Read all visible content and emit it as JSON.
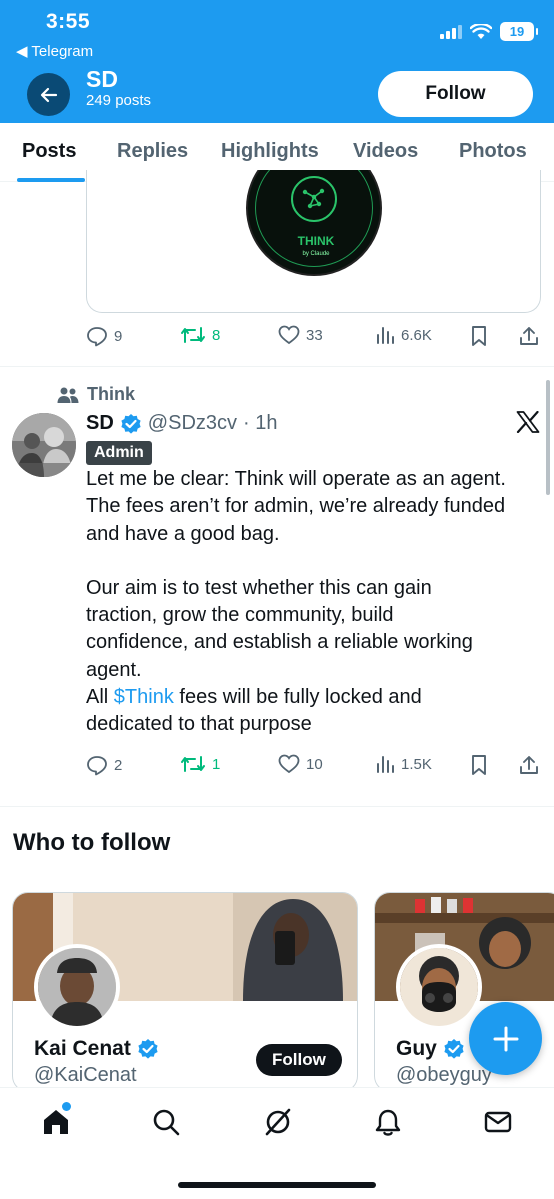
{
  "status_bar": {
    "time": "3:55",
    "back_app": "◀ Telegram",
    "battery": "19"
  },
  "header": {
    "name": "SD",
    "posts": "249 posts",
    "follow_label": "Follow"
  },
  "tabs": [
    {
      "label": "Posts",
      "active": true
    },
    {
      "label": "Replies"
    },
    {
      "label": "Highlights"
    },
    {
      "label": "Videos"
    },
    {
      "label": "Photos"
    }
  ],
  "post1": {
    "image": {
      "logo_text": "THINK",
      "logo_sub": "by Claude"
    },
    "replies": "9",
    "reposts": "8",
    "likes": "33",
    "views": "6.6K"
  },
  "post2": {
    "community": "Think",
    "name": "SD",
    "handle": "@SDz3cv",
    "time": "· 1h",
    "badge": "Admin",
    "text_lines": [
      "Let me be clear: Think will operate as an agent.",
      "The fees aren’t for admin, we’re already funded",
      "and have a good bag."
    ],
    "text_lines2": [
      "Our aim is to test whether this can gain",
      "traction, grow the community, build",
      "confidence, and establish a reliable working",
      "agent."
    ],
    "text_line_cashtag_prefix": "All ",
    "cashtag": "$Think",
    "text_line_cashtag_suffix": " fees will be fully locked and",
    "text_last": "dedicated to that purpose",
    "replies": "2",
    "reposts": "1",
    "likes": "10",
    "views": "1.5K"
  },
  "who_to_follow": {
    "title": "Who to follow",
    "cards": [
      {
        "name": "Kai Cenat",
        "handle": "@KaiCenat",
        "follow_label": "Follow"
      },
      {
        "name": "Guy",
        "handle": "@obeyguy"
      }
    ]
  },
  "colors": {
    "accent": "#1d9bf0",
    "repost_green": "#00ba7c",
    "text": "#0f1419",
    "muted": "#536471"
  },
  "nav_icons": [
    "home-icon",
    "search-icon",
    "grok-icon",
    "bell-icon",
    "mail-icon"
  ]
}
